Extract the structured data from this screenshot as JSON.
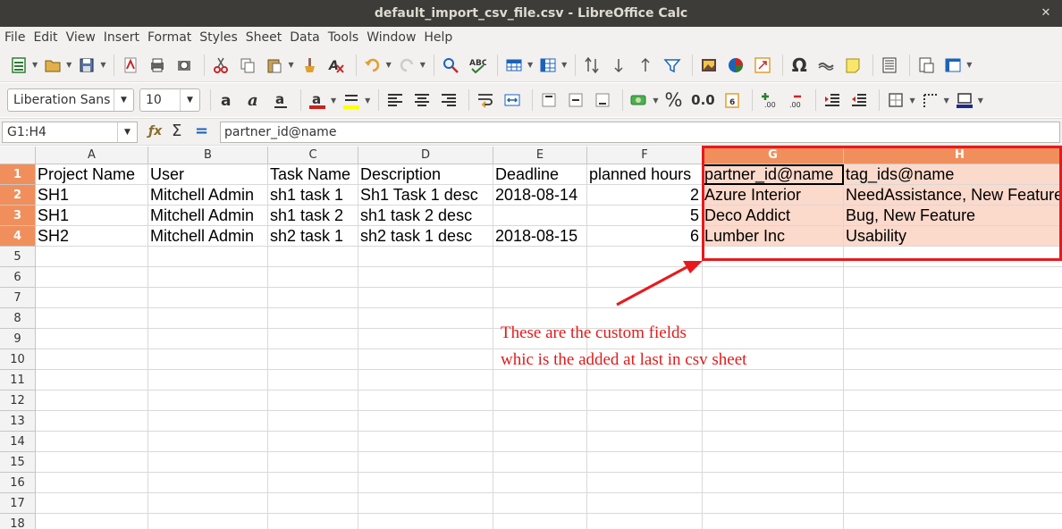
{
  "window": {
    "title": "default_import_csv_file.csv - LibreOffice Calc",
    "close_glyph": "✕"
  },
  "menu": [
    "File",
    "Edit",
    "View",
    "Insert",
    "Format",
    "Styles",
    "Sheet",
    "Data",
    "Tools",
    "Window",
    "Help"
  ],
  "font": {
    "name": "Liberation Sans",
    "size": "10"
  },
  "formula_bar": {
    "name_box": "G1:H4",
    "formula": "partner_id@name"
  },
  "columns": [
    {
      "label": "A",
      "selected": false
    },
    {
      "label": "B",
      "selected": false
    },
    {
      "label": "C",
      "selected": false
    },
    {
      "label": "D",
      "selected": false
    },
    {
      "label": "E",
      "selected": false
    },
    {
      "label": "F",
      "selected": false
    },
    {
      "label": "G",
      "selected": true
    },
    {
      "label": "H",
      "selected": true
    }
  ],
  "rows": [
    {
      "num": "1",
      "cells": [
        "Project Name",
        "User",
        "Task Name",
        "Description",
        "Deadline",
        "planned hours",
        "partner_id@name",
        "tag_ids@name"
      ]
    },
    {
      "num": "2",
      "cells": [
        "SH1",
        "Mitchell Admin",
        "sh1 task 1",
        "Sh1 Task 1 desc",
        "2018-08-14",
        "2",
        "Azure Interior",
        "NeedAssistance, New Feature"
      ]
    },
    {
      "num": "3",
      "cells": [
        "SH1",
        "Mitchell Admin",
        "sh1 task 2",
        "sh1 task 2 desc",
        "",
        "5",
        "Deco Addict",
        "Bug, New Feature"
      ]
    },
    {
      "num": "4",
      "cells": [
        "SH2",
        "Mitchell Admin",
        "sh2 task 1",
        "sh2 task 1 desc",
        "2018-08-15",
        "6",
        "Lumber Inc",
        "Usability"
      ]
    },
    {
      "num": "5",
      "cells": [
        "",
        "",
        "",
        "",
        "",
        "",
        "",
        ""
      ]
    },
    {
      "num": "6",
      "cells": [
        "",
        "",
        "",
        "",
        "",
        "",
        "",
        ""
      ]
    },
    {
      "num": "7",
      "cells": [
        "",
        "",
        "",
        "",
        "",
        "",
        "",
        ""
      ]
    },
    {
      "num": "8",
      "cells": [
        "",
        "",
        "",
        "",
        "",
        "",
        "",
        ""
      ]
    },
    {
      "num": "9",
      "cells": [
        "",
        "",
        "",
        "",
        "",
        "",
        "",
        ""
      ]
    },
    {
      "num": "10",
      "cells": [
        "",
        "",
        "",
        "",
        "",
        "",
        "",
        ""
      ]
    },
    {
      "num": "11",
      "cells": [
        "",
        "",
        "",
        "",
        "",
        "",
        "",
        ""
      ]
    },
    {
      "num": "12",
      "cells": [
        "",
        "",
        "",
        "",
        "",
        "",
        "",
        ""
      ]
    },
    {
      "num": "13",
      "cells": [
        "",
        "",
        "",
        "",
        "",
        "",
        "",
        ""
      ]
    },
    {
      "num": "14",
      "cells": [
        "",
        "",
        "",
        "",
        "",
        "",
        "",
        ""
      ]
    },
    {
      "num": "15",
      "cells": [
        "",
        "",
        "",
        "",
        "",
        "",
        "",
        ""
      ]
    },
    {
      "num": "16",
      "cells": [
        "",
        "",
        "",
        "",
        "",
        "",
        "",
        ""
      ]
    },
    {
      "num": "17",
      "cells": [
        "",
        "",
        "",
        "",
        "",
        "",
        "",
        ""
      ]
    },
    {
      "num": "18",
      "cells": [
        "",
        "",
        "",
        "",
        "",
        "",
        "",
        ""
      ]
    }
  ],
  "annotation": {
    "line1": "These are the custom fields",
    "line2": "whic is the added at last in csv sheet",
    "color": "#e01b1b"
  },
  "toolbar_icons": {
    "row1": [
      "new-icon",
      "open-icon",
      "save-icon",
      "export-pdf-icon",
      "print-icon",
      "print-preview-icon",
      "cut-icon",
      "copy-icon",
      "paste-icon",
      "clone-formatting-icon",
      "clear-formatting-icon",
      "undo-icon",
      "redo-icon",
      "find-replace-icon",
      "spelling-icon",
      "row-icon",
      "column-icon",
      "sort-icon",
      "sort-ascending-icon",
      "sort-descending-icon",
      "autofilter-icon",
      "image-icon",
      "chart-icon",
      "pivot-table-icon",
      "special-character-icon",
      "hyperlink-icon",
      "comment-icon",
      "headers-footers-icon",
      "define-print-area-icon",
      "freeze-rows-columns-icon"
    ],
    "row2": [
      "bold-icon",
      "italic-icon",
      "underline-icon",
      "font-color-icon",
      "highlight-icon",
      "align-left-icon",
      "align-center-icon",
      "align-right-icon",
      "wrap-text-icon",
      "merge-cells-icon",
      "align-top-icon",
      "center-vertically-icon",
      "align-bottom-icon",
      "currency-icon",
      "percent-icon",
      "number-icon",
      "date-icon",
      "add-decimal-icon",
      "delete-decimal-icon",
      "increase-indent-icon",
      "decrease-indent-icon",
      "borders-icon",
      "border-style-icon",
      "border-color-icon"
    ]
  }
}
